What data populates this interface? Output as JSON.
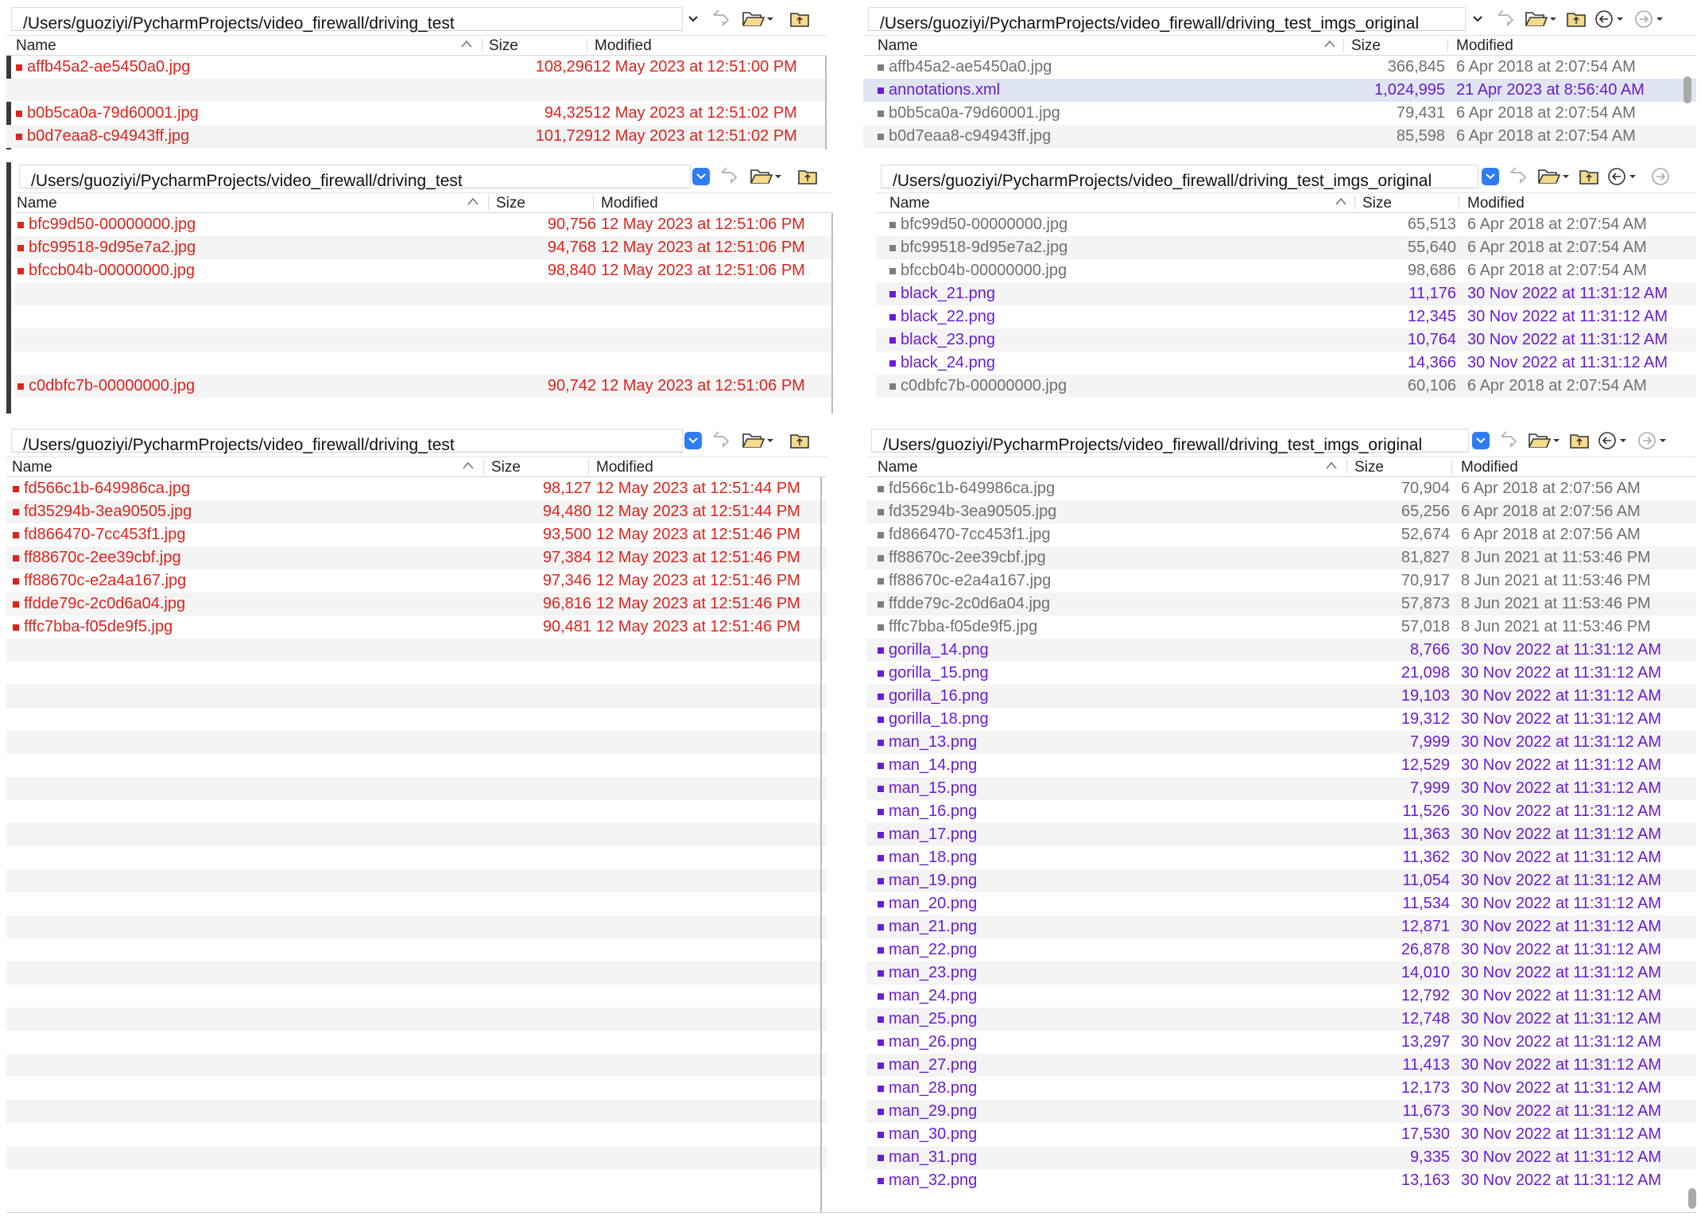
{
  "columns": {
    "name": "Name",
    "size": "Size",
    "modified": "Modified"
  },
  "colors": {
    "missing": "#e0231c",
    "same": "#707070",
    "unique": "#6b1ad8",
    "dropdown_active": "#2f7cf6"
  },
  "panels": [
    {
      "left": {
        "path": "/Users/guoziyi/PycharmProjects/video_firewall/driving_test",
        "rows": [
          {
            "name": "affb45a2-ae5450a0.jpg",
            "size": "108,296",
            "modified": "12 May 2023 at 12:51:00 PM",
            "status": "red"
          },
          {
            "name": "",
            "size": "",
            "modified": "",
            "status": "blank"
          },
          {
            "name": "b0b5ca0a-79d60001.jpg",
            "size": "94,325",
            "modified": "12 May 2023 at 12:51:02 PM",
            "status": "red"
          },
          {
            "name": "b0d7eaa8-c94943ff.jpg",
            "size": "101,729",
            "modified": "12 May 2023 at 12:51:02 PM",
            "status": "red"
          }
        ]
      },
      "right": {
        "path": "/Users/guoziyi/PycharmProjects/video_firewall/driving_test_imgs_original",
        "rows": [
          {
            "name": "affb45a2-ae5450a0.jpg",
            "size": "366,845",
            "modified": "6 Apr 2018 at 2:07:54 AM",
            "status": "gray"
          },
          {
            "name": "annotations.xml",
            "size": "1,024,995",
            "modified": "21 Apr 2023 at 8:56:40 AM",
            "status": "purple",
            "selected": true
          },
          {
            "name": "b0b5ca0a-79d60001.jpg",
            "size": "79,431",
            "modified": "6 Apr 2018 at 2:07:54 AM",
            "status": "gray"
          },
          {
            "name": "b0d7eaa8-c94943ff.jpg",
            "size": "85,598",
            "modified": "6 Apr 2018 at 2:07:54 AM",
            "status": "gray"
          }
        ]
      }
    },
    {
      "left": {
        "path": "/Users/guoziyi/PycharmProjects/video_firewall/driving_test",
        "rows": [
          {
            "name": "bfc99d50-00000000.jpg",
            "size": "90,756",
            "modified": "12 May 2023 at 12:51:06 PM",
            "status": "red"
          },
          {
            "name": "bfc99518-9d95e7a2.jpg",
            "size": "94,768",
            "modified": "12 May 2023 at 12:51:06 PM",
            "status": "red"
          },
          {
            "name": "bfccb04b-00000000.jpg",
            "size": "98,840",
            "modified": "12 May 2023 at 12:51:06 PM",
            "status": "red"
          },
          {
            "name": "",
            "size": "",
            "modified": "",
            "status": "blank"
          },
          {
            "name": "",
            "size": "",
            "modified": "",
            "status": "blank"
          },
          {
            "name": "",
            "size": "",
            "modified": "",
            "status": "blank"
          },
          {
            "name": "",
            "size": "",
            "modified": "",
            "status": "blank"
          },
          {
            "name": "c0dbfc7b-00000000.jpg",
            "size": "90,742",
            "modified": "12 May 2023 at 12:51:06 PM",
            "status": "red"
          }
        ]
      },
      "right": {
        "path": "/Users/guoziyi/PycharmProjects/video_firewall/driving_test_imgs_original",
        "rows": [
          {
            "name": "bfc99d50-00000000.jpg",
            "size": "65,513",
            "modified": "6 Apr 2018 at 2:07:54 AM",
            "status": "gray"
          },
          {
            "name": "bfc99518-9d95e7a2.jpg",
            "size": "55,640",
            "modified": "6 Apr 2018 at 2:07:54 AM",
            "status": "gray"
          },
          {
            "name": "bfccb04b-00000000.jpg",
            "size": "98,686",
            "modified": "6 Apr 2018 at 2:07:54 AM",
            "status": "gray"
          },
          {
            "name": "black_21.png",
            "size": "11,176",
            "modified": "30 Nov 2022 at 11:31:12 AM",
            "status": "purple"
          },
          {
            "name": "black_22.png",
            "size": "12,345",
            "modified": "30 Nov 2022 at 11:31:12 AM",
            "status": "purple"
          },
          {
            "name": "black_23.png",
            "size": "10,764",
            "modified": "30 Nov 2022 at 11:31:12 AM",
            "status": "purple"
          },
          {
            "name": "black_24.png",
            "size": "14,366",
            "modified": "30 Nov 2022 at 11:31:12 AM",
            "status": "purple"
          },
          {
            "name": "c0dbfc7b-00000000.jpg",
            "size": "60,106",
            "modified": "6 Apr 2018 at 2:07:54 AM",
            "status": "gray"
          }
        ]
      }
    },
    {
      "left": {
        "path": "/Users/guoziyi/PycharmProjects/video_firewall/driving_test",
        "rows": [
          {
            "name": "fd566c1b-649986ca.jpg",
            "size": "98,127",
            "modified": "12 May 2023 at 12:51:44 PM",
            "status": "red"
          },
          {
            "name": "fd35294b-3ea90505.jpg",
            "size": "94,480",
            "modified": "12 May 2023 at 12:51:44 PM",
            "status": "red"
          },
          {
            "name": "fd866470-7cc453f1.jpg",
            "size": "93,500",
            "modified": "12 May 2023 at 12:51:46 PM",
            "status": "red"
          },
          {
            "name": "ff88670c-2ee39cbf.jpg",
            "size": "97,384",
            "modified": "12 May 2023 at 12:51:46 PM",
            "status": "red"
          },
          {
            "name": "ff88670c-e2a4a167.jpg",
            "size": "97,346",
            "modified": "12 May 2023 at 12:51:46 PM",
            "status": "red"
          },
          {
            "name": "ffdde79c-2c0d6a04.jpg",
            "size": "96,816",
            "modified": "12 May 2023 at 12:51:46 PM",
            "status": "red"
          },
          {
            "name": "fffc7bba-f05de9f5.jpg",
            "size": "90,481",
            "modified": "12 May 2023 at 12:51:46 PM",
            "status": "red"
          }
        ]
      },
      "right": {
        "path": "/Users/guoziyi/PycharmProjects/video_firewall/driving_test_imgs_original",
        "rows": [
          {
            "name": "fd566c1b-649986ca.jpg",
            "size": "70,904",
            "modified": "6 Apr 2018 at 2:07:56 AM",
            "status": "gray"
          },
          {
            "name": "fd35294b-3ea90505.jpg",
            "size": "65,256",
            "modified": "6 Apr 2018 at 2:07:56 AM",
            "status": "gray"
          },
          {
            "name": "fd866470-7cc453f1.jpg",
            "size": "52,674",
            "modified": "6 Apr 2018 at 2:07:56 AM",
            "status": "gray"
          },
          {
            "name": "ff88670c-2ee39cbf.jpg",
            "size": "81,827",
            "modified": "8 Jun 2021 at 11:53:46 PM",
            "status": "gray"
          },
          {
            "name": "ff88670c-e2a4a167.jpg",
            "size": "70,917",
            "modified": "8 Jun 2021 at 11:53:46 PM",
            "status": "gray"
          },
          {
            "name": "ffdde79c-2c0d6a04.jpg",
            "size": "57,873",
            "modified": "8 Jun 2021 at 11:53:46 PM",
            "status": "gray"
          },
          {
            "name": "fffc7bba-f05de9f5.jpg",
            "size": "57,018",
            "modified": "8 Jun 2021 at 11:53:46 PM",
            "status": "gray"
          },
          {
            "name": "gorilla_14.png",
            "size": "8,766",
            "modified": "30 Nov 2022 at 11:31:12 AM",
            "status": "purple"
          },
          {
            "name": "gorilla_15.png",
            "size": "21,098",
            "modified": "30 Nov 2022 at 11:31:12 AM",
            "status": "purple"
          },
          {
            "name": "gorilla_16.png",
            "size": "19,103",
            "modified": "30 Nov 2022 at 11:31:12 AM",
            "status": "purple"
          },
          {
            "name": "gorilla_18.png",
            "size": "19,312",
            "modified": "30 Nov 2022 at 11:31:12 AM",
            "status": "purple"
          },
          {
            "name": "man_13.png",
            "size": "7,999",
            "modified": "30 Nov 2022 at 11:31:12 AM",
            "status": "purple"
          },
          {
            "name": "man_14.png",
            "size": "12,529",
            "modified": "30 Nov 2022 at 11:31:12 AM",
            "status": "purple"
          },
          {
            "name": "man_15.png",
            "size": "7,999",
            "modified": "30 Nov 2022 at 11:31:12 AM",
            "status": "purple"
          },
          {
            "name": "man_16.png",
            "size": "11,526",
            "modified": "30 Nov 2022 at 11:31:12 AM",
            "status": "purple"
          },
          {
            "name": "man_17.png",
            "size": "11,363",
            "modified": "30 Nov 2022 at 11:31:12 AM",
            "status": "purple"
          },
          {
            "name": "man_18.png",
            "size": "11,362",
            "modified": "30 Nov 2022 at 11:31:12 AM",
            "status": "purple"
          },
          {
            "name": "man_19.png",
            "size": "11,054",
            "modified": "30 Nov 2022 at 11:31:12 AM",
            "status": "purple"
          },
          {
            "name": "man_20.png",
            "size": "11,534",
            "modified": "30 Nov 2022 at 11:31:12 AM",
            "status": "purple"
          },
          {
            "name": "man_21.png",
            "size": "12,871",
            "modified": "30 Nov 2022 at 11:31:12 AM",
            "status": "purple"
          },
          {
            "name": "man_22.png",
            "size": "26,878",
            "modified": "30 Nov 2022 at 11:31:12 AM",
            "status": "purple"
          },
          {
            "name": "man_23.png",
            "size": "14,010",
            "modified": "30 Nov 2022 at 11:31:12 AM",
            "status": "purple"
          },
          {
            "name": "man_24.png",
            "size": "12,792",
            "modified": "30 Nov 2022 at 11:31:12 AM",
            "status": "purple"
          },
          {
            "name": "man_25.png",
            "size": "12,748",
            "modified": "30 Nov 2022 at 11:31:12 AM",
            "status": "purple"
          },
          {
            "name": "man_26.png",
            "size": "13,297",
            "modified": "30 Nov 2022 at 11:31:12 AM",
            "status": "purple"
          },
          {
            "name": "man_27.png",
            "size": "11,413",
            "modified": "30 Nov 2022 at 11:31:12 AM",
            "status": "purple"
          },
          {
            "name": "man_28.png",
            "size": "12,173",
            "modified": "30 Nov 2022 at 11:31:12 AM",
            "status": "purple"
          },
          {
            "name": "man_29.png",
            "size": "11,673",
            "modified": "30 Nov 2022 at 11:31:12 AM",
            "status": "purple"
          },
          {
            "name": "man_30.png",
            "size": "17,530",
            "modified": "30 Nov 2022 at 11:31:12 AM",
            "status": "purple"
          },
          {
            "name": "man_31.png",
            "size": "9,335",
            "modified": "30 Nov 2022 at 11:31:12 AM",
            "status": "purple"
          },
          {
            "name": "man_32.png",
            "size": "13,163",
            "modified": "30 Nov 2022 at 11:31:12 AM",
            "status": "purple"
          }
        ]
      }
    }
  ]
}
